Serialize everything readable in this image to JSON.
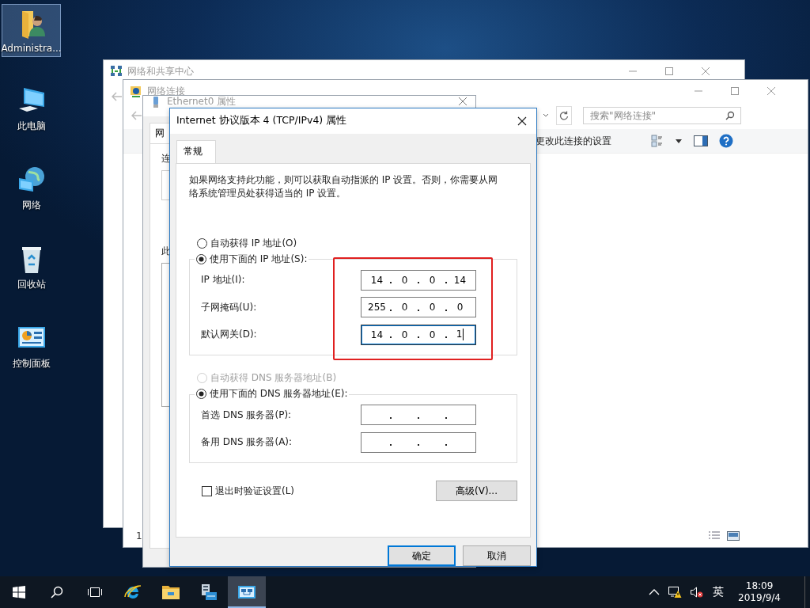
{
  "desktop_icons": [
    {
      "kind": "user-folder",
      "label": "Administra...",
      "selected": true
    },
    {
      "kind": "computer",
      "label": "此电脑",
      "selected": false
    },
    {
      "kind": "network",
      "label": "网络",
      "selected": false
    },
    {
      "kind": "recycle-bin",
      "label": "回收站",
      "selected": false
    },
    {
      "kind": "control-panel",
      "label": "控制面板",
      "selected": false
    }
  ],
  "windows": {
    "sharing_center": {
      "title": "网络和共享中心"
    },
    "connections": {
      "title": "网络连接",
      "search": {
        "placeholder": "搜索\"网络连接\""
      },
      "toolbar_action": "更改此连接的设置",
      "status_text": "1"
    },
    "ethernet": {
      "title": "Ethernet0 属性",
      "tab": "网",
      "labels": [
        "连",
        "此"
      ]
    }
  },
  "dialog": {
    "title": "Internet 协议版本 4 (TCP/IPv4) 属性",
    "tabs": [
      {
        "label": "常规",
        "selected": true
      }
    ],
    "description": "如果网络支持此功能，则可以获取自动指派的 IP 设置。否则，你需要从网络系统管理员处获得适当的 IP 设置。",
    "ip_options": [
      {
        "label": "自动获得 IP 地址(O)",
        "selected": false,
        "disabled": false
      },
      {
        "label": "使用下面的 IP 地址(S):",
        "selected": true,
        "disabled": false
      }
    ],
    "ip_fields": [
      {
        "label": "IP 地址(I):",
        "octets": [
          "14",
          "0",
          "0",
          "14"
        ],
        "focused": false
      },
      {
        "label": "子网掩码(U):",
        "octets": [
          "255",
          "0",
          "0",
          "0"
        ],
        "focused": false
      },
      {
        "label": "默认网关(D):",
        "octets": [
          "14",
          "0",
          "0",
          "1"
        ],
        "focused": true
      }
    ],
    "dns_options": [
      {
        "label": "自动获得 DNS 服务器地址(B)",
        "selected": false,
        "disabled": true
      },
      {
        "label": "使用下面的 DNS 服务器地址(E):",
        "selected": true,
        "disabled": false
      }
    ],
    "dns_fields": [
      {
        "label": "首选 DNS 服务器(P):",
        "focused": false
      },
      {
        "label": "备用 DNS 服务器(A):",
        "focused": false
      }
    ],
    "validate": {
      "label": "退出时验证设置(L)",
      "checked": false
    },
    "advanced_button": "高级(V)...",
    "buttons": [
      {
        "label": "确定",
        "default": true
      },
      {
        "label": "取消",
        "default": false
      }
    ]
  },
  "taskbar": {
    "apps": [
      {
        "kind": "start",
        "active": false
      },
      {
        "kind": "search",
        "active": false
      },
      {
        "kind": "task-view",
        "active": false
      },
      {
        "kind": "browser",
        "active": false
      },
      {
        "kind": "folder",
        "active": false
      },
      {
        "kind": "server-manager",
        "active": false
      },
      {
        "kind": "network-connections",
        "active": true
      }
    ],
    "language": "英",
    "time": "18:09",
    "date": "2019/9/4"
  }
}
